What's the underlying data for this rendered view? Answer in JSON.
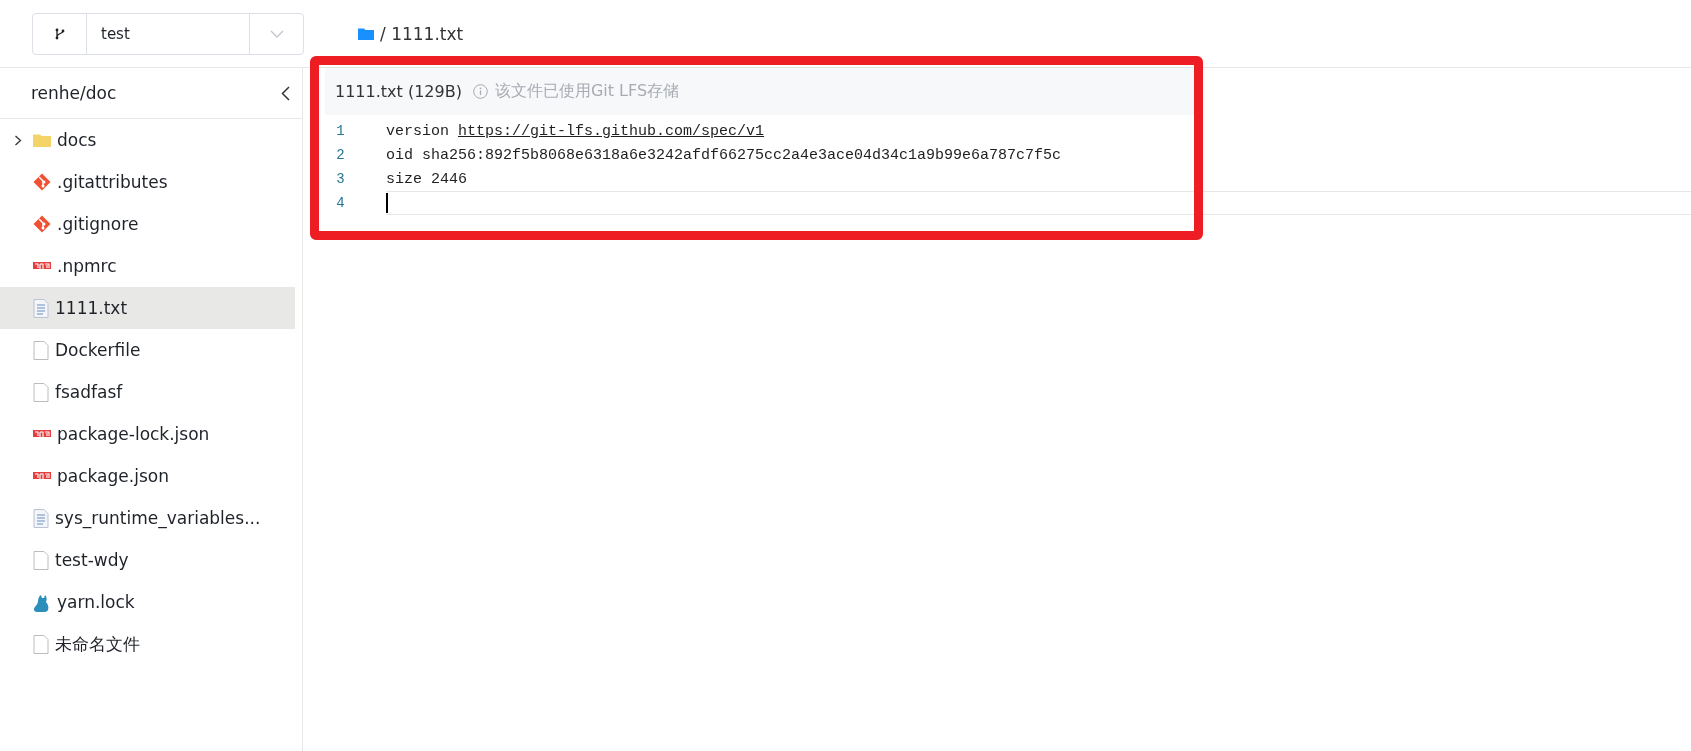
{
  "branch_selector": {
    "value": "test"
  },
  "breadcrumb": {
    "separator": "/",
    "file": "1111.txt"
  },
  "sidebar": {
    "title": "renhe/doc",
    "items": [
      {
        "name": "docs",
        "kind": "folder",
        "selected": false,
        "expanded": false
      },
      {
        "name": ".gitattributes",
        "kind": "git",
        "selected": false
      },
      {
        "name": ".gitignore",
        "kind": "git",
        "selected": false
      },
      {
        "name": ".npmrc",
        "kind": "npm",
        "selected": false
      },
      {
        "name": "1111.txt",
        "kind": "text",
        "selected": true
      },
      {
        "name": "Dockerfile",
        "kind": "file",
        "selected": false
      },
      {
        "name": "fsadfasf",
        "kind": "file",
        "selected": false
      },
      {
        "name": "package-lock.json",
        "kind": "npm",
        "selected": false
      },
      {
        "name": "package.json",
        "kind": "npm",
        "selected": false
      },
      {
        "name": "sys_runtime_variables...",
        "kind": "text",
        "selected": false
      },
      {
        "name": "test-wdy",
        "kind": "file",
        "selected": false
      },
      {
        "name": "yarn.lock",
        "kind": "yarn",
        "selected": false
      },
      {
        "name": "未命名文件",
        "kind": "file",
        "selected": false
      }
    ]
  },
  "file_view": {
    "title": "1111.txt (129B)",
    "notice": "该文件已使用Git LFS存储",
    "highlight_box": true,
    "lines": [
      {
        "number": "1",
        "current": false,
        "segments": [
          {
            "text": "version ",
            "link": false
          },
          {
            "text": "https://git-lfs.github.com/spec/v1",
            "link": true
          }
        ]
      },
      {
        "number": "2",
        "current": false,
        "segments": [
          {
            "text": "oid sha256:892f5b8068e6318a6e3242afdf66275cc2a4e3ace04d34c1a9b99e6a787c7f5c",
            "link": false
          }
        ]
      },
      {
        "number": "3",
        "current": false,
        "segments": [
          {
            "text": "size 2446",
            "link": false
          }
        ]
      },
      {
        "number": "4",
        "current": true
      }
    ]
  }
}
